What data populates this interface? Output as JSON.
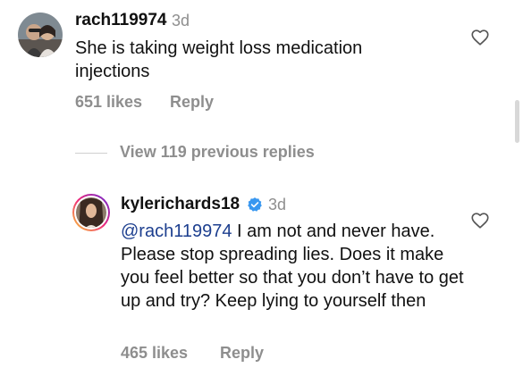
{
  "comments": [
    {
      "username": "rach119974",
      "time": "3d",
      "text": "She is taking weight loss medication injections",
      "likes": "651 likes",
      "reply_label": "Reply"
    },
    {
      "username": "kylerichards18",
      "verified": true,
      "time": "3d",
      "mention": "@rach119974",
      "text": " I am not and never have. Please stop spreading lies. Does it make you feel better so that you don’t have to get up and try? Keep lying to yourself then",
      "likes": "465 likes",
      "reply_label": "Reply"
    }
  ],
  "view_replies": "View 119 previous replies",
  "colors": {
    "verified": "#3897f0",
    "mention": "#1d3f8f",
    "muted": "#8e8e8e",
    "story_ring_start": "#f9ce34",
    "story_ring_end": "#ee2a7b"
  },
  "icons": [
    "heart-icon",
    "verified-badge-icon"
  ]
}
